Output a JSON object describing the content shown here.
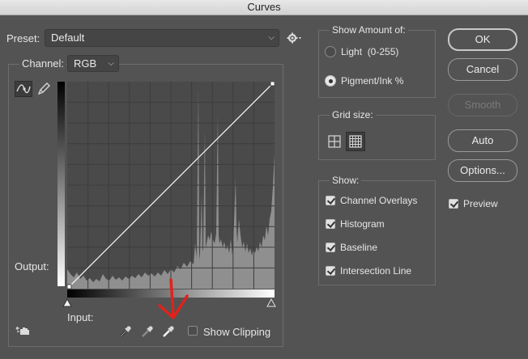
{
  "window": {
    "title": "Curves"
  },
  "preset": {
    "label": "Preset:",
    "value": "Default"
  },
  "channel": {
    "label": "Channel:",
    "value": "RGB"
  },
  "graph": {
    "output_label": "Output:",
    "input_label": "Input:"
  },
  "show_clipping": {
    "label": "Show Clipping",
    "checked": false
  },
  "show_amount": {
    "title": "Show Amount of:",
    "options": [
      {
        "label": "Light  (0-255)",
        "selected": false
      },
      {
        "label": "Pigment/Ink %",
        "selected": true
      }
    ]
  },
  "grid_size": {
    "title": "Grid size:"
  },
  "show": {
    "title": "Show:",
    "items": [
      {
        "label": "Channel Overlays",
        "checked": true
      },
      {
        "label": "Histogram",
        "checked": true
      },
      {
        "label": "Baseline",
        "checked": true
      },
      {
        "label": "Intersection Line",
        "checked": true
      }
    ]
  },
  "buttons": {
    "ok": "OK",
    "cancel": "Cancel",
    "smooth": "Smooth",
    "auto": "Auto",
    "options": "Options..."
  },
  "preview": {
    "label": "Preview",
    "checked": true
  },
  "colors": {
    "annotation_arrow": "#e0221b",
    "dialog_bg": "#535353",
    "graph_bg": "#4a4a4a",
    "histogram": "#8f8f8f"
  },
  "icons": [
    "curve-tool-icon",
    "pencil-icon",
    "gear-icon",
    "targeted-adjustment-icon",
    "black-point-eyedropper-icon",
    "gray-point-eyedropper-icon",
    "white-point-eyedropper-icon",
    "simple-grid-icon",
    "detailed-grid-icon"
  ]
}
